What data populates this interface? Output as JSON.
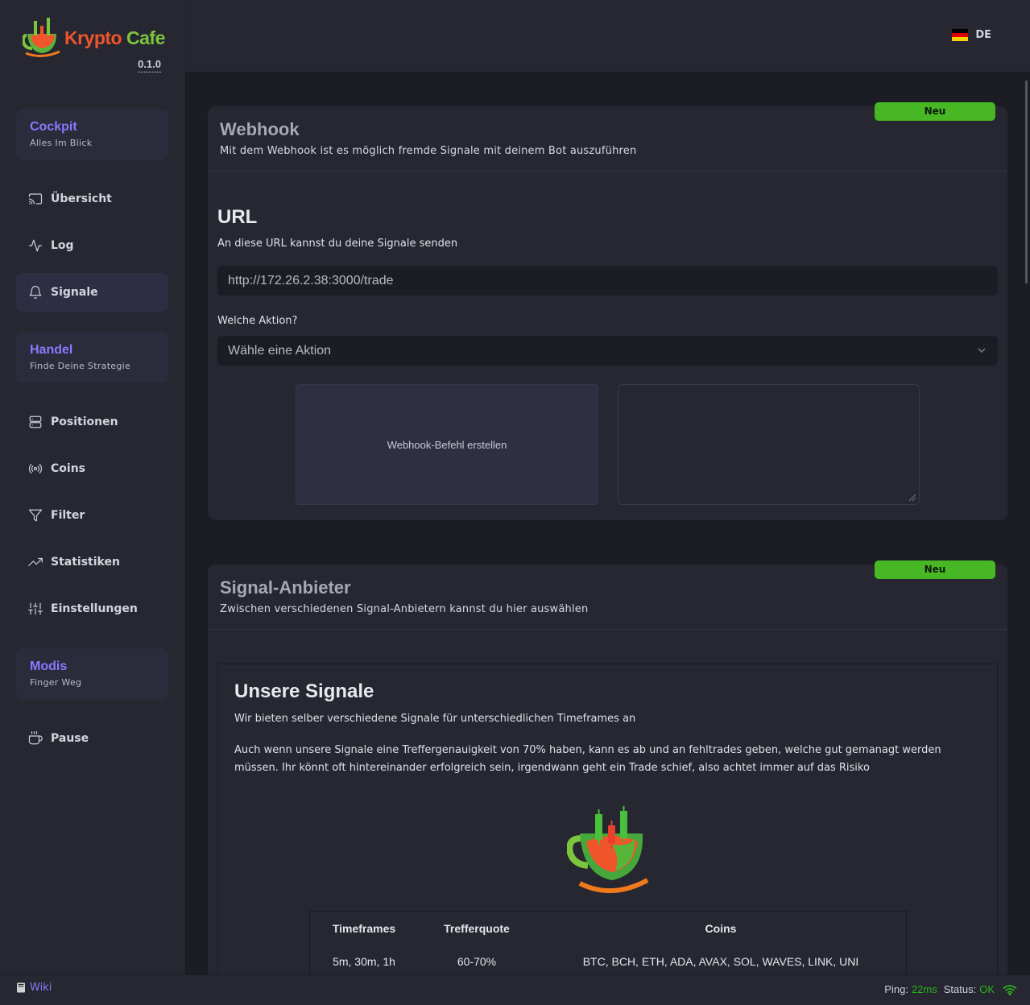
{
  "app": {
    "name_part1": "Krypto",
    "name_part2": "Cafe",
    "version": "0.1.0",
    "language": "DE"
  },
  "sidebar": {
    "sections": [
      {
        "title": "Cockpit",
        "subtitle": "Alles Im Blick"
      },
      {
        "title": "Handel",
        "subtitle": "Finde Deine Strategie"
      },
      {
        "title": "Modis",
        "subtitle": "Finger Weg"
      }
    ],
    "items": [
      {
        "label": "Übersicht",
        "icon": "cast-icon"
      },
      {
        "label": "Log",
        "icon": "activity-icon"
      },
      {
        "label": "Signale",
        "icon": "bell-icon",
        "active": true
      },
      {
        "label": "Positionen",
        "icon": "server-icon"
      },
      {
        "label": "Coins",
        "icon": "radio-icon"
      },
      {
        "label": "Filter",
        "icon": "filter-icon"
      },
      {
        "label": "Statistiken",
        "icon": "trending-up-icon"
      },
      {
        "label": "Einstellungen",
        "icon": "sliders-icon"
      },
      {
        "label": "Pause",
        "icon": "coffee-icon"
      }
    ]
  },
  "webhook": {
    "badge": "Neu",
    "title": "Webhook",
    "subtitle": "Mit dem Webhook ist es möglich fremde Signale mit deinem Bot auszuführen",
    "url_title": "URL",
    "url_subtitle": "An diese URL kannst du deine Signale senden",
    "url_value": "http://172.26.2.38:3000/trade",
    "action_label": "Welche Aktion?",
    "action_placeholder": "Wähle eine Aktion",
    "create_button": "Webhook-Befehl erstellen"
  },
  "providers": {
    "badge": "Neu",
    "title": "Signal-Anbieter",
    "subtitle": "Zwischen verschiedenen Signal-Anbietern kannst du hier auswählen",
    "own": {
      "title": "Unsere Signale",
      "subtitle": "Wir bieten selber verschiedene Signale für unterschiedlichen Timeframes an",
      "paragraph": "Auch wenn unsere Signale eine Treffergenauigkeit von 70% haben, kann es ab und an fehltrades geben, welche gut gemanagt werden müssen. Ihr könnt oft hintereinander erfolgreich sein, irgendwann geht ein Trade schief, also achtet immer auf das Risiko",
      "table": {
        "headers": [
          "Timeframes",
          "Trefferquote",
          "Coins"
        ],
        "rows": [
          [
            "5m, 30m, 1h",
            "60-70%",
            "BTC, BCH, ETH, ADA, AVAX, SOL, WAVES, LINK, UNI"
          ]
        ]
      }
    }
  },
  "statusbar": {
    "wiki": "Wiki",
    "ping_label": "Ping:",
    "ping_value": "22ms",
    "status_label": "Status:",
    "status_value": "OK"
  },
  "colors": {
    "accent": "#8a78ff",
    "badge": "#47b824",
    "ok": "#28b619",
    "logo_orange": "#f0552b",
    "logo_green": "#7cc63d"
  }
}
